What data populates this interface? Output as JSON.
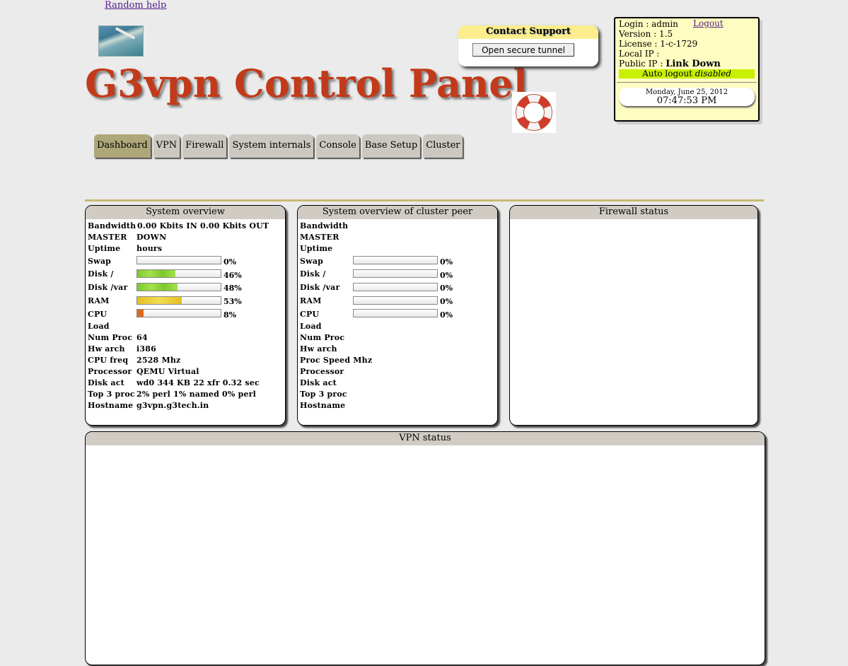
{
  "header": {
    "random_help": "Random help",
    "title": "G3vpn Control Panel"
  },
  "support": {
    "title": "Contact Support",
    "tunnel_button": "Open secure tunnel"
  },
  "info": {
    "login": "Login : admin",
    "logout": "Logout",
    "version": "Version : 1.5",
    "license": "License : 1-c-1729",
    "local_ip": "Local IP :",
    "public_ip_label": "Public IP :",
    "public_ip_value": "Link Down",
    "autologout_label": "Auto logout",
    "autologout_value": "disabled",
    "date": "Monday, June 25, 2012",
    "time": "07:47:53 PM"
  },
  "tabs": [
    {
      "label": "Dashboard",
      "active": true
    },
    {
      "label": "VPN",
      "active": false
    },
    {
      "label": "Firewall",
      "active": false
    },
    {
      "label": "System internals",
      "active": false
    },
    {
      "label": "Console",
      "active": false
    },
    {
      "label": "Base Setup",
      "active": false
    },
    {
      "label": "Cluster",
      "active": false
    }
  ],
  "system_overview": {
    "title": "System overview",
    "bandwidth_label": "Bandwidth",
    "bandwidth_value": "0.00 Kbits IN 0.00 Kbits OUT",
    "master_label": "MASTER",
    "master_value": "DOWN",
    "uptime_label": "Uptime",
    "uptime_value": "hours",
    "swap_label": "Swap",
    "swap_pct": "0%",
    "swap_fraction": 0,
    "disk_root_label": "Disk /",
    "disk_root_pct": "46%",
    "disk_root_fraction": 0.46,
    "disk_var_label": "Disk /var",
    "disk_var_pct": "48%",
    "disk_var_fraction": 0.48,
    "ram_label": "RAM",
    "ram_pct": "53%",
    "ram_fraction": 0.53,
    "cpu_label": "CPU",
    "cpu_pct": "8%",
    "cpu_fraction": 0.08,
    "load_label": "Load",
    "numproc_label": "Num Proc",
    "numproc_value": "64",
    "hwarch_label": "Hw arch",
    "hwarch_value": "i386",
    "cpufreq_label": "CPU freq",
    "cpufreq_value": "2528 Mhz",
    "processor_label": "Processor",
    "processor_value": "QEMU Virtual",
    "diskact_label": "Disk act",
    "diskact_value": "wd0 344 KB 22 xfr 0.32 sec",
    "top3_label": "Top 3 proc",
    "top3_value": "2% perl 1% named 0% perl",
    "hostname_label": "Hostname",
    "hostname_value": "g3vpn.g3tech.in"
  },
  "peer_overview": {
    "title": "System overview of cluster peer",
    "bandwidth_label": "Bandwidth",
    "master_label": "MASTER",
    "uptime_label": "Uptime",
    "swap_label": "Swap",
    "swap_pct": "0%",
    "disk_root_label": "Disk /",
    "disk_root_pct": "0%",
    "disk_var_label": "Disk /var",
    "disk_var_pct": "0%",
    "ram_label": "RAM",
    "ram_pct": "0%",
    "cpu_label": "CPU",
    "cpu_pct": "0%",
    "fraction": 0,
    "load_label": "Load",
    "numproc_label": "Num Proc",
    "hwarch_label": "Hw arch",
    "procspeed_label": "Proc Speed",
    "procspeed_value": "Mhz",
    "processor_label": "Processor",
    "diskact_label": "Disk act",
    "top3_label": "Top 3 proc",
    "hostname_label": "Hostname"
  },
  "firewall": {
    "title": "Firewall status"
  },
  "vpn": {
    "title": "VPN status"
  },
  "colors": {
    "title_red": "#c23a1a",
    "active_tab": "#aea77a",
    "tab": "#ccc8c0",
    "autologout_bg": "#c8f000",
    "info_bg": "#fefcc0",
    "support_header": "#fcee8c"
  }
}
